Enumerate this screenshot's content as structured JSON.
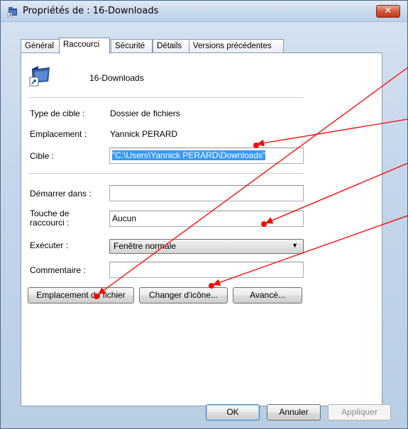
{
  "window": {
    "title": "Propriétés de : 16-Downloads",
    "close_label": "✕"
  },
  "tabs": [
    {
      "label": "Général",
      "active": false
    },
    {
      "label": "Raccourci",
      "active": true
    },
    {
      "label": "Sécurité",
      "active": false
    },
    {
      "label": "Détails",
      "active": false
    },
    {
      "label": "Versions précédentes",
      "active": false
    }
  ],
  "shortcut": {
    "name": "16-Downloads",
    "target_type_label": "Type de cible :",
    "target_type_value": "Dossier de fichiers",
    "location_label": "Emplacement :",
    "location_value": "Yannick PERARD",
    "target_label": "Cible :",
    "target_value": "\"C:\\Users\\Yannick PERARD\\Downloads\"",
    "start_in_label": "Démarrer dans :",
    "start_in_value": "",
    "hotkey_label_line1": "Touche de",
    "hotkey_label_line2": "raccourci :",
    "hotkey_value": "Aucun",
    "run_label": "Exécuter :",
    "run_value": "Fenêtre normale",
    "comment_label": "Commentaire :",
    "comment_value": ""
  },
  "buttons": {
    "open_location": "Emplacement du fichier",
    "change_icon": "Changer d'icône...",
    "advanced": "Avancé...",
    "ok": "OK",
    "cancel": "Annuler",
    "apply": "Appliquer"
  },
  "colors": {
    "annotation": "#ff0000",
    "selection": "#3399ff"
  }
}
